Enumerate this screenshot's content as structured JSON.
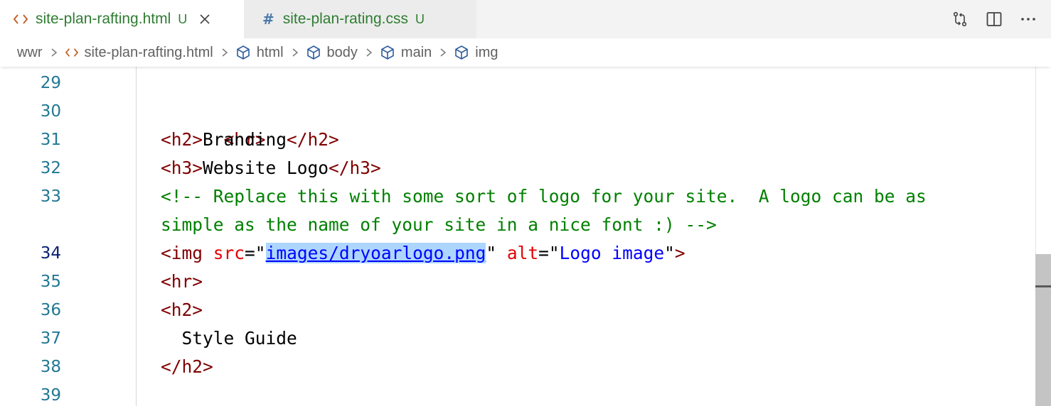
{
  "tabs": [
    {
      "icon": "html-file-icon",
      "name": "site-plan-rafting.html",
      "status": "U",
      "active": true
    },
    {
      "icon": "css-file-icon",
      "name": "site-plan-rating.css",
      "status": "U",
      "active": false
    }
  ],
  "tab_actions": [
    "open-changes-icon",
    "split-editor-icon",
    "more-actions-icon"
  ],
  "breadcrumb": {
    "folder": "wwr",
    "file": "site-plan-rafting.html",
    "symbols": [
      "html",
      "body",
      "main",
      "img"
    ]
  },
  "editor": {
    "line_numbers": {
      "l29": "29",
      "l30": "30",
      "l31": "31",
      "l32": "32",
      "l33": "33",
      "l34": "34",
      "l35": "35",
      "l36": "36",
      "l37": "37",
      "l38": "38",
      "l39": "39"
    },
    "current_line": "34",
    "code": {
      "l30": {
        "tag": "<hr>"
      },
      "l31": {
        "open": "<h2>",
        "text": "Branding",
        "close": "</h2>"
      },
      "l32": {
        "open": "<h3>",
        "text": "Website Logo",
        "close": "</h3>"
      },
      "l33": {
        "comment_1": "<!-- Replace this with some sort of logo for your site.  A logo can be as",
        "comment_2": "simple as the name of your site in a nice font :) -->"
      },
      "l34": {
        "open": "<img",
        "attr_src": "src",
        "eq1": "=\"",
        "src_value": "images/dryoarlogo.png",
        "q1": "\"",
        "attr_alt": "alt",
        "eq2": "=\"",
        "alt_value": "Logo image",
        "q2": "\"",
        "close": ">"
      },
      "l35": {
        "tag": "<hr>"
      },
      "l36": {
        "tag": "<h2>"
      },
      "l37": {
        "text": "  Style Guide"
      },
      "l38": {
        "tag": "</h2>"
      }
    }
  },
  "colors": {
    "tag": "#800000",
    "attribute": "#e50000",
    "string": "#0000ff",
    "comment": "#008000",
    "line_number": "#237893",
    "selection": "#add6ff",
    "untracked": "#2f7d32"
  }
}
